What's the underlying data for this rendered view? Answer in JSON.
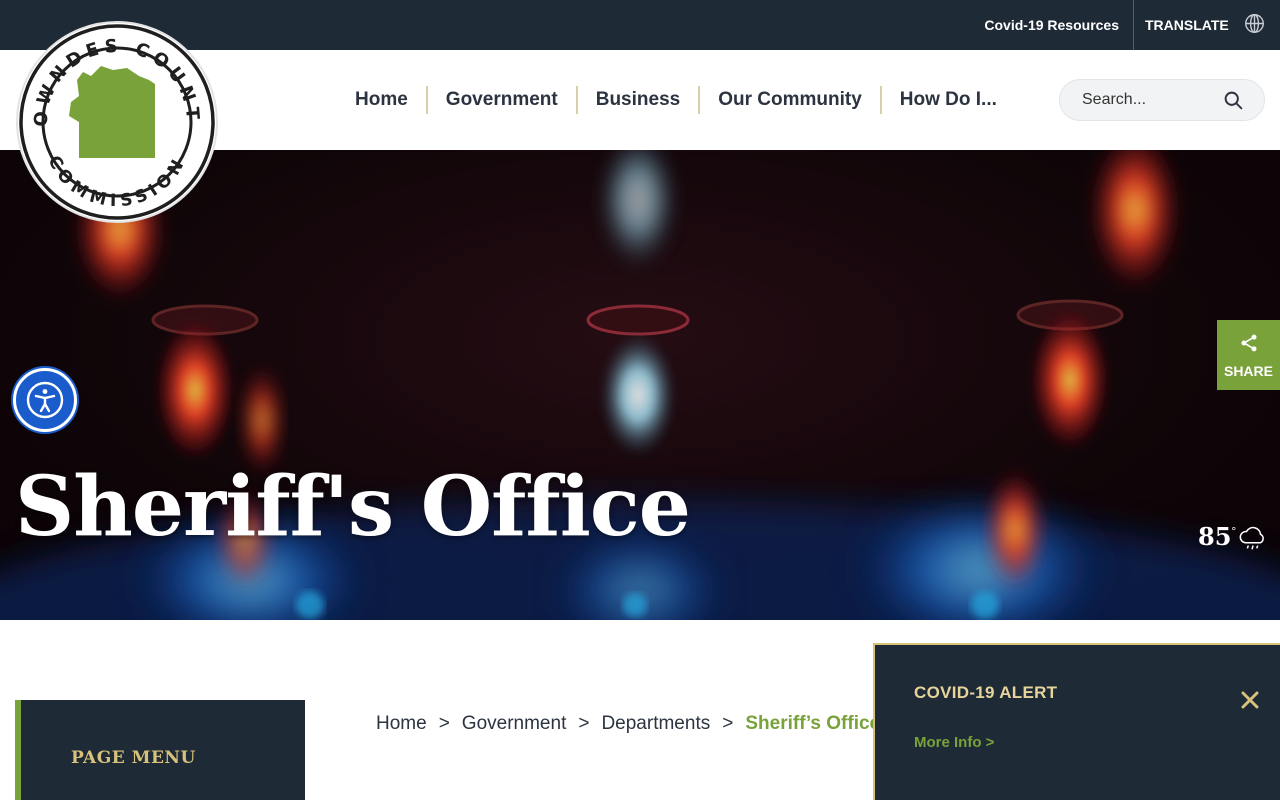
{
  "topbar": {
    "covid_link": "Covid-19 Resources",
    "translate_label": "TRANSLATE",
    "globe_icon": "globe-icon"
  },
  "logo": {
    "top_text": "LOWNDES COUNTY",
    "bottom_text": "COMMISSION",
    "accent_color": "#7aa23b"
  },
  "nav": {
    "items": [
      {
        "label": "Home"
      },
      {
        "label": "Government"
      },
      {
        "label": "Business"
      },
      {
        "label": "Our Community"
      },
      {
        "label": "How Do I..."
      }
    ]
  },
  "search": {
    "placeholder": "Search...",
    "icon": "search-icon"
  },
  "hero": {
    "title": "Sheriff's Office",
    "weather": {
      "temp": "85",
      "degree": "°",
      "icon": "rain-cloud-icon"
    }
  },
  "share": {
    "label": "SHARE",
    "icon": "share-icon"
  },
  "accessibility": {
    "icon": "accessibility-icon"
  },
  "page_menu": {
    "label": "PAGE MENU"
  },
  "breadcrumb": {
    "items": [
      "Home",
      "Government",
      "Departments"
    ],
    "current": "Sheriff’s Office",
    "separator": ">"
  },
  "alert": {
    "title": "COVID-19 ALERT",
    "link": "More Info >",
    "close_icon": "close-icon"
  },
  "colors": {
    "dark_navy": "#1f2a37",
    "brand_green": "#7aa23b",
    "gold": "#d8c27a",
    "accessibility_blue": "#1a5ccc"
  }
}
